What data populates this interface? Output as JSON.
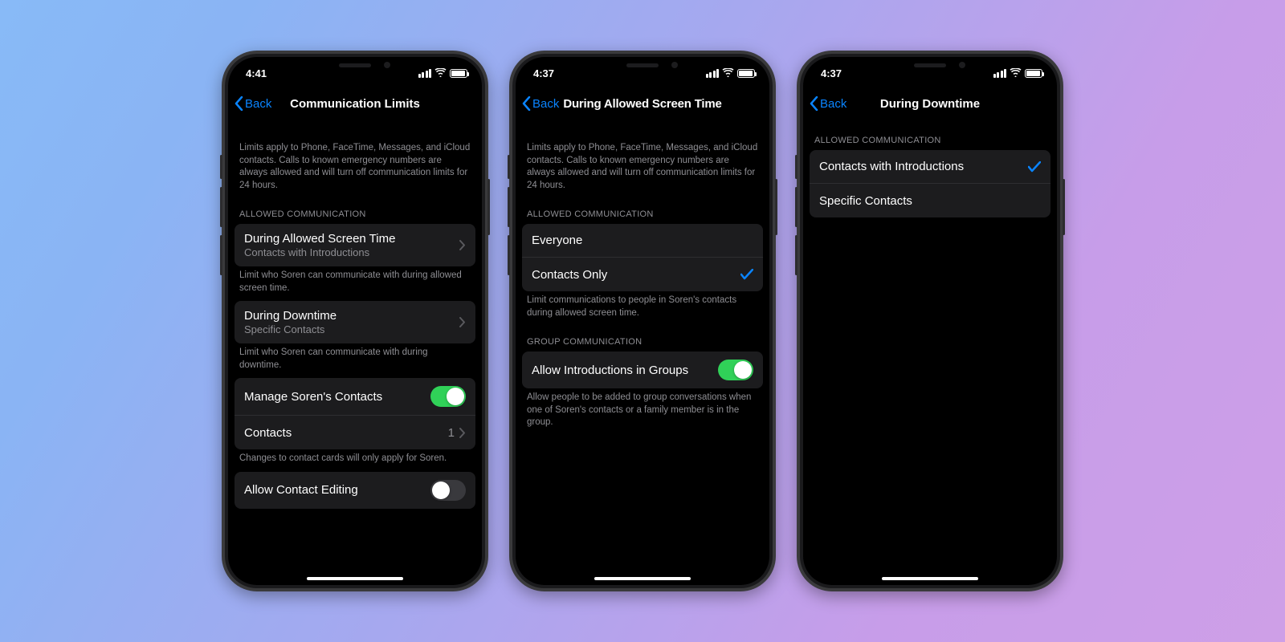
{
  "phones": [
    {
      "status_time": "4:41",
      "back_label": "Back",
      "nav_title": "Communication Limits",
      "intro_desc": "Limits apply to Phone, FaceTime, Messages, and iCloud contacts. Calls to known emergency numbers are always allowed and will turn off communication limits for 24 hours.",
      "sec1_header": "ALLOWED COMMUNICATION",
      "sec1_item1_title": "During Allowed Screen Time",
      "sec1_item1_sub": "Contacts with Introductions",
      "sec1_footer": "Limit who Soren can communicate with during allowed screen time.",
      "sec2_item1_title": "During Downtime",
      "sec2_item1_sub": "Specific Contacts",
      "sec2_footer": "Limit who Soren can communicate with during downtime.",
      "sec3_item1_title": "Manage Soren's Contacts",
      "sec3_item1_toggle": true,
      "sec3_item2_title": "Contacts",
      "sec3_item2_value": "1",
      "sec3_footer": "Changes to contact cards will only apply for Soren.",
      "sec4_item1_title": "Allow Contact Editing",
      "sec4_item1_toggle": false
    },
    {
      "status_time": "4:37",
      "back_label": "Back",
      "nav_title": "During Allowed Screen Time",
      "intro_desc": "Limits apply to Phone, FaceTime, Messages, and iCloud contacts. Calls to known emergency numbers are always allowed and will turn off communication limits for 24 hours.",
      "sec1_header": "ALLOWED COMMUNICATION",
      "sec1_item1_title": "Everyone",
      "sec1_item2_title": "Contacts Only",
      "sec1_item2_selected": true,
      "sec1_footer": "Limit communications to people in Soren's contacts during allowed screen time.",
      "sec2_header": "GROUP COMMUNICATION",
      "sec2_item1_title": "Allow Introductions in Groups",
      "sec2_item1_toggle": true,
      "sec2_footer": "Allow people to be added to group conversations when one of Soren's contacts or a family member is in the group."
    },
    {
      "status_time": "4:37",
      "back_label": "Back",
      "nav_title": "During Downtime",
      "sec1_header": "ALLOWED COMMUNICATION",
      "sec1_item1_title": "Contacts with Introductions",
      "sec1_item1_selected": true,
      "sec1_item2_title": "Specific Contacts"
    }
  ]
}
